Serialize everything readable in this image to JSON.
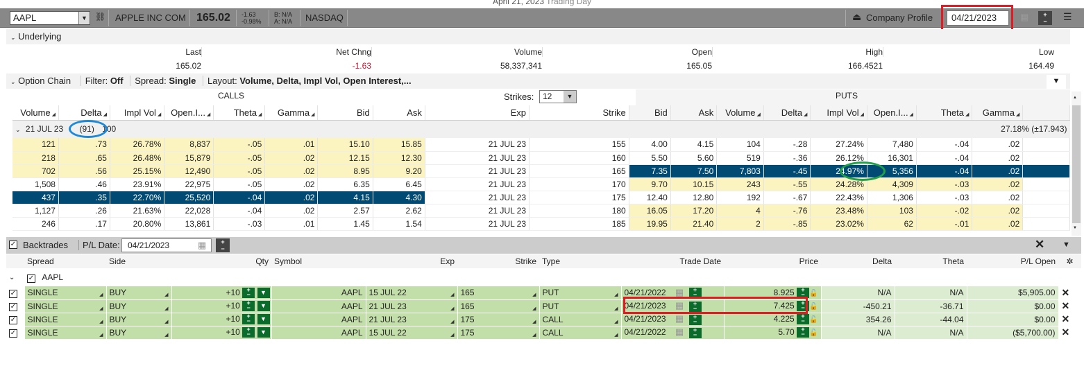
{
  "title": {
    "date": "April 21, 2023",
    "label": "Trading Day"
  },
  "topbar": {
    "symbol": "AAPL",
    "company": "APPLE INC COM",
    "price": "165.02",
    "change": "-1.63",
    "change_pct": "-0.98%",
    "bid": "B: N/A",
    "ask": "A: N/A",
    "exchange": "NASDAQ",
    "company_profile": "Company Profile",
    "date": "04/21/2023"
  },
  "underlying": {
    "label": "Underlying",
    "headers": [
      "Last",
      "Net Chng",
      "Volume",
      "Open",
      "High",
      "Low"
    ],
    "values": [
      "165.02",
      "-1.63",
      "58,337,341",
      "165.05",
      "166.4521",
      "164.49"
    ]
  },
  "chain_toolbar": {
    "label": "Option Chain",
    "filter_label": "Filter:",
    "filter_value": "Off",
    "spread_label": "Spread:",
    "spread_value": "Single",
    "layout_label": "Layout:",
    "layout_value": "Volume, Delta, Impl Vol, Open Interest,..."
  },
  "chain": {
    "calls_label": "CALLS",
    "puts_label": "PUTS",
    "strikes_label": "Strikes:",
    "strikes_value": "12",
    "call_headers": [
      "Volume",
      "Delta",
      "Impl Vol",
      "Open.I...",
      "Theta",
      "Gamma",
      "Bid",
      "Ask"
    ],
    "mid_headers": [
      "Exp",
      "Strike"
    ],
    "put_headers": [
      "Bid",
      "Ask",
      "Volume",
      "Delta",
      "Impl Vol",
      "Open.I...",
      "Theta",
      "Gamma"
    ],
    "expiry_label": "21 JUL 23",
    "expiry_days": "(91)",
    "expiry_mult": "100",
    "expiry_iv": "27.18% (±17.943)",
    "rows": [
      {
        "c": [
          "121",
          ".73",
          "26.78%",
          "8,837",
          "-.05",
          ".01",
          "15.10",
          "15.85"
        ],
        "exp": "21 JUL 23",
        "strike": "155",
        "p": [
          "4.00",
          "4.15",
          "104",
          "-.28",
          "27.24%",
          "7,480",
          "-.04",
          ".02"
        ]
      },
      {
        "c": [
          "218",
          ".65",
          "26.48%",
          "15,879",
          "-.05",
          ".02",
          "12.15",
          "12.30"
        ],
        "exp": "21 JUL 23",
        "strike": "160",
        "p": [
          "5.50",
          "5.60",
          "519",
          "-.36",
          "26.12%",
          "16,301",
          "-.04",
          ".02"
        ]
      },
      {
        "c": [
          "702",
          ".56",
          "25.15%",
          "12,490",
          "-.05",
          ".02",
          "8.95",
          "9.20"
        ],
        "exp": "21 JUL 23",
        "strike": "165",
        "p": [
          "7.35",
          "7.50",
          "7,803",
          "-.45",
          "24.97%",
          "5,356",
          "-.04",
          ".02"
        ]
      },
      {
        "c": [
          "1,508",
          ".46",
          "23.91%",
          "22,975",
          "-.05",
          ".02",
          "6.35",
          "6.45"
        ],
        "exp": "21 JUL 23",
        "strike": "170",
        "p": [
          "9.70",
          "10.15",
          "243",
          "-.55",
          "24.28%",
          "4,309",
          "-.03",
          ".02"
        ]
      },
      {
        "c": [
          "437",
          ".35",
          "22.70%",
          "25,520",
          "-.04",
          ".02",
          "4.15",
          "4.30"
        ],
        "exp": "21 JUL 23",
        "strike": "175",
        "p": [
          "12.40",
          "12.80",
          "192",
          "-.67",
          "22.43%",
          "1,306",
          "-.03",
          ".02"
        ]
      },
      {
        "c": [
          "1,127",
          ".26",
          "21.63%",
          "22,028",
          "-.04",
          ".02",
          "2.57",
          "2.62"
        ],
        "exp": "21 JUL 23",
        "strike": "180",
        "p": [
          "16.05",
          "17.20",
          "4",
          "-.76",
          "23.48%",
          "103",
          "-.02",
          ".02"
        ]
      },
      {
        "c": [
          "246",
          ".17",
          "20.80%",
          "13,861",
          "-.03",
          ".01",
          "1.45",
          "1.54"
        ],
        "exp": "21 JUL 23",
        "strike": "185",
        "p": [
          "19.95",
          "21.40",
          "2",
          "-.85",
          "23.02%",
          "62",
          "-.01",
          ".02"
        ]
      }
    ]
  },
  "backtrades": {
    "label": "Backtrades",
    "pl_date_label": "P/L Date:",
    "pl_date": "04/21/2023",
    "headers": [
      "Spread",
      "Side",
      "Qty",
      "Symbol",
      "Exp",
      "Strike",
      "Type",
      "Trade Date",
      "Price",
      "Delta",
      "Theta",
      "P/L Open"
    ],
    "group": "AAPL",
    "rows": [
      {
        "spread": "SINGLE",
        "side": "BUY",
        "qty": "+10",
        "symbol": "AAPL",
        "exp": "15 JUL 22",
        "strike": "165",
        "type": "PUT",
        "date": "04/21/2022",
        "price": "8.925",
        "delta": "N/A",
        "theta": "N/A",
        "pl": "$5,905.00"
      },
      {
        "spread": "SINGLE",
        "side": "BUY",
        "qty": "+10",
        "symbol": "AAPL",
        "exp": "21 JUL 23",
        "strike": "165",
        "type": "PUT",
        "date": "04/21/2023",
        "price": "7.425",
        "delta": "-450.21",
        "theta": "-36.71",
        "pl": "$0.00"
      },
      {
        "spread": "SINGLE",
        "side": "BUY",
        "qty": "+10",
        "symbol": "AAPL",
        "exp": "21 JUL 23",
        "strike": "175",
        "type": "CALL",
        "date": "04/21/2023",
        "price": "4.225",
        "delta": "354.26",
        "theta": "-44.04",
        "pl": "$0.00"
      },
      {
        "spread": "SINGLE",
        "side": "BUY",
        "qty": "+10",
        "symbol": "AAPL",
        "exp": "15 JUL 22",
        "strike": "175",
        "type": "CALL",
        "date": "04/21/2022",
        "price": "5.70",
        "delta": "N/A",
        "theta": "N/A",
        "pl": "($5,700.00)"
      }
    ]
  },
  "colors": {
    "selected": "#004a73",
    "call_itm": "#fbf3c0",
    "trade_row": "#c3dfa9",
    "annotation_red": "#e01b24",
    "annotation_blue": "#1e88d8",
    "annotation_green": "#21a04a"
  }
}
